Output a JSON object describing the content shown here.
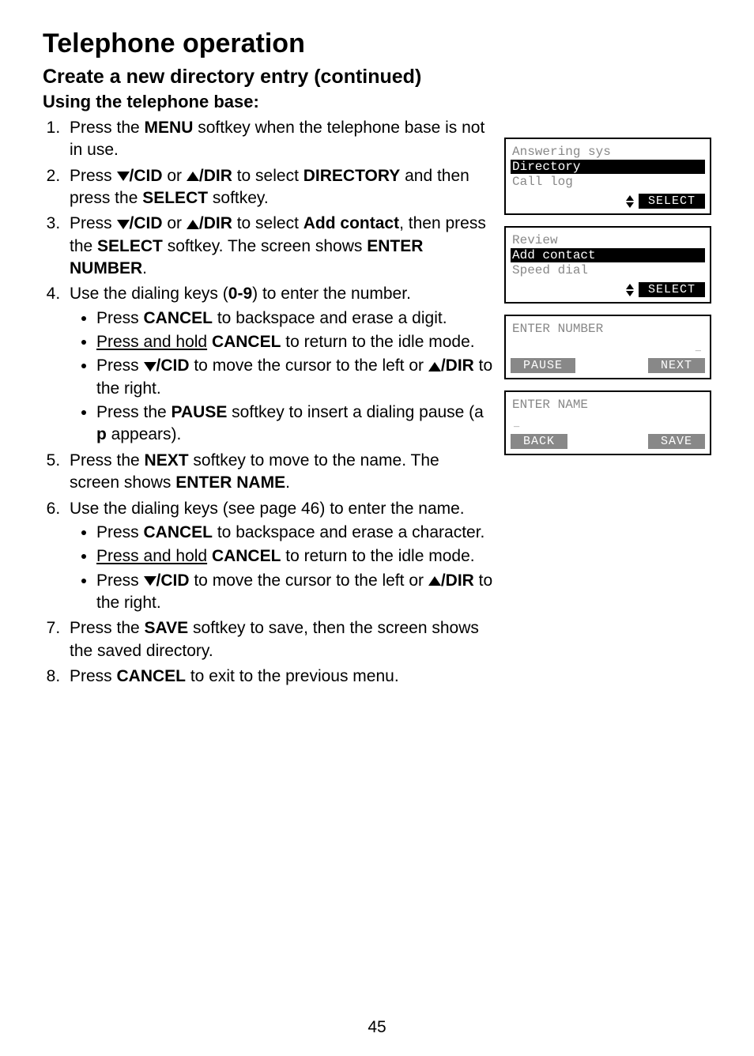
{
  "page": {
    "title": "Telephone operation",
    "subtitle": "Create a new directory entry (continued)",
    "subsub": "Using the telephone base:",
    "pagenum": "45"
  },
  "steps": {
    "s1a": "Press the ",
    "s1_menu": "MENU",
    "s1b": " softkey when the telephone base is not in use.",
    "s2a": "Press ",
    "s2_cid": "/CID",
    "s2_or": " or ",
    "s2_dir": "/DIR",
    "s2b": " to select ",
    "s2_directory": "DIRECTORY",
    "s2c": " and then press the ",
    "s2_select": "SELECT",
    "s2d": " softkey.",
    "s3a": "Press ",
    "s3b": " to select ",
    "s3_add": "Add contact",
    "s3c": ", then press the ",
    "s3_select": "SELECT",
    "s3d": " softkey. The screen shows ",
    "s3_enter": "ENTER NUMBER",
    "s3e": ".",
    "s4a": "Use the dialing keys (",
    "s4_keys": "0-9",
    "s4b": ") to enter the number.",
    "s4_b1a": "Press ",
    "s4_b1_cancel": "CANCEL",
    "s4_b1b": " to backspace and erase a digit.",
    "s4_b2a": "Press and hold",
    "s4_b2_cancel": "CANCEL",
    "s4_b2b": " to return to the idle mode.",
    "s4_b3a": "Press ",
    "s4_b3b": " to move the cursor to the left or ",
    "s4_b3c": " to the right.",
    "s4_b4a": "Press the ",
    "s4_b4_pause": "PAUSE",
    "s4_b4b": " softkey to insert a dialing pause (a ",
    "s4_b4_p": "p",
    "s4_b4c": " appears).",
    "s5a": "Press the ",
    "s5_next": "NEXT",
    "s5b": " softkey to move to the name. The screen shows ",
    "s5_enter": "ENTER NAME",
    "s5c": ".",
    "s6a": "Use the dialing keys (see page 46) to enter the name.",
    "s6_b1a": "Press ",
    "s6_b1_cancel": "CANCEL",
    "s6_b1b": " to backspace and erase a character.",
    "s6_b2a": "Press and hold",
    "s6_b2_cancel": "CANCEL",
    "s6_b2b": " to return to the idle mode.",
    "s6_b3a": "Press ",
    "s6_b3b": " to move the cursor to the left or ",
    "s6_b3c": " to the right.",
    "s7a": "Press the ",
    "s7_save": "SAVE",
    "s7b": " softkey to save, then the screen shows the saved directory.",
    "s8a": "Press ",
    "s8_cancel": "CANCEL",
    "s8b": " to exit to the previous menu."
  },
  "screens": {
    "scr1": {
      "row1": "Answering sys",
      "row2": "Directory",
      "row3": "Call log",
      "select": "SELECT"
    },
    "scr2": {
      "row1": "Review",
      "row2": "Add contact",
      "row3": "Speed dial",
      "select": "SELECT"
    },
    "scr3": {
      "title": "ENTER NUMBER",
      "cursor": "_",
      "left": "PAUSE",
      "right": "NEXT"
    },
    "scr4": {
      "title": "ENTER NAME",
      "cursor": "_",
      "left": "BACK",
      "right": "SAVE"
    }
  }
}
